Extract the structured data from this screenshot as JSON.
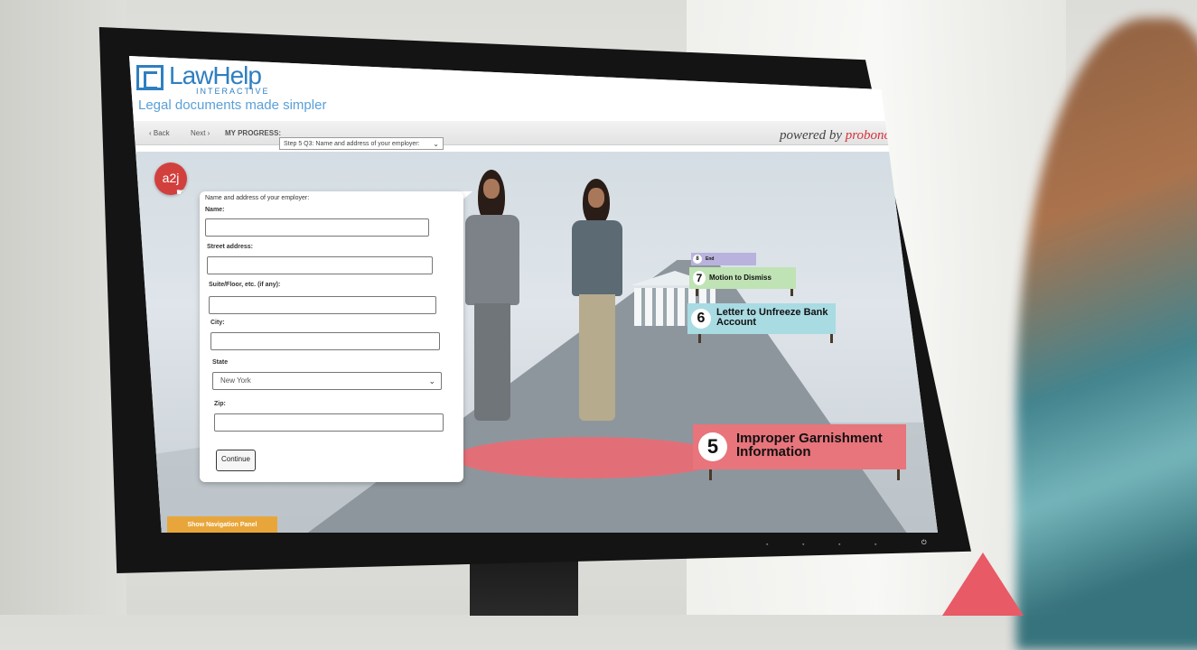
{
  "header": {
    "logo_main": "LawHelp",
    "logo_sub": "INTERACTIVE",
    "tagline": "Legal documents made simpler",
    "powered_prefix": "powered by",
    "powered_brand": "probono.net"
  },
  "toolbar": {
    "back_label": "‹ Back",
    "next_label": "Next ›",
    "progress_label": "MY PROGRESS:",
    "progress_value": "Step 5 Q3: Name and address of your employer:"
  },
  "assistant": {
    "badge": "a2j"
  },
  "form": {
    "prompt": "Name and address of your employer:",
    "name_label": "Name:",
    "name_value": "",
    "street_label": "Street address:",
    "street_value": "",
    "suite_label": "Suite/Floor, etc. (if any):",
    "suite_value": "",
    "city_label": "City:",
    "city_value": "",
    "state_label": "State",
    "state_value": "New York",
    "zip_label": "Zip:",
    "zip_value": "",
    "continue_label": "Continue"
  },
  "nav_panel_label": "Show Navigation Panel",
  "signs": [
    {
      "num": "8",
      "label": "End",
      "color": "#b9b2dc"
    },
    {
      "num": "7",
      "label": "Motion to Dismiss",
      "color": "#bfe3b4"
    },
    {
      "num": "6",
      "label": "Letter to Unfreeze Bank Account",
      "color": "#a9dbe3"
    },
    {
      "num": "5",
      "label": "Improper Garnishment Information",
      "color": "#e8747c"
    }
  ],
  "colors": {
    "brand_blue": "#2f7fc1",
    "accent_red": "#d4343c",
    "nav_orange": "#e8a63a"
  }
}
